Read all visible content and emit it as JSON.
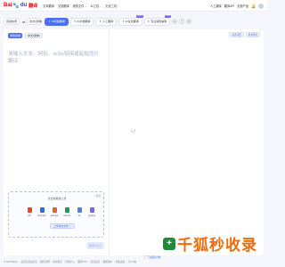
{
  "header": {
    "logo_text_bai": "Bai",
    "logo_paw": "🐾",
    "logo_text_du": "du",
    "logo_text_fy": "翻译",
    "nav": [
      {
        "label": "文本翻译",
        "has_caret": false
      },
      {
        "label": "文档翻译",
        "has_caret": false
      },
      {
        "label": "我的文件",
        "has_caret": true
      },
      {
        "label": "AI工具",
        "has_caret": true
      },
      {
        "label": "文化工具",
        "has_caret": true
      }
    ],
    "right_nav": [
      "人工翻译",
      "翻译API",
      "全部产品"
    ],
    "caret": "⌄"
  },
  "funcbar": {
    "from_lang": "自动检测",
    "to_lang": "中文(简体)",
    "swap_icon": "⇄",
    "tabs": [
      {
        "label": "AI风格翻译",
        "icon": "✦",
        "active": true,
        "badge": ""
      },
      {
        "label": "AI文档翻译",
        "icon": "✦",
        "active": false,
        "badge": ""
      },
      {
        "label": "人工翻译",
        "icon": "✦",
        "active": false,
        "badge": ""
      },
      {
        "label": "AI论文翻译",
        "icon": "✦",
        "active": false,
        "badge": "NEW"
      },
      {
        "label": "专业润色编辑",
        "icon": "✦",
        "active": false,
        "badge": "NEW"
      }
    ],
    "icon_buttons": [
      "⊕",
      "◷",
      "⚙"
    ]
  },
  "editor": {
    "mode_active": "通用领域",
    "mode_secondary": "中文(简体)",
    "right_actions": [
      "双语对照",
      "复制译文"
    ],
    "placeholder_prefix": "请输入文本、网址、arXiv链接或粘贴",
    "placeholder_link": "图片",
    "placeholder_suffix": "",
    "placeholder_line2": "翻译",
    "upload_title": "点击或拖拽上传",
    "feedback": "◐ 反馈",
    "formats": [
      {
        "label": "pdf",
        "color": "#e5482c"
      },
      {
        "label": "docx/doc",
        "color": "#2b6cd8"
      },
      {
        "label": "pptx/ppt",
        "color": "#e5602c"
      },
      {
        "label": "xlsx/xls",
        "color": "#1f9b55"
      },
      {
        "label": "txt",
        "color": "#5c7cdb"
      },
      {
        "label": "jpg/png",
        "color": "#7b61ff"
      }
    ],
    "upload_button": "上传本地文件 ⌄",
    "translate_button": "翻译(⌘⏎)"
  },
  "footer": {
    "links": [
      "© 2025 Baidu",
      "使用百度前必读",
      "翻译官网",
      "联系我们",
      "帮助中心",
      "翻译APP",
      "意见反馈",
      "数据保护",
      "隐私政策",
      "京ICP备"
    ],
    "app_download": "▢ 下载客户端"
  },
  "watermark": {
    "icon": "+",
    "text": "千狐秒收录"
  }
}
